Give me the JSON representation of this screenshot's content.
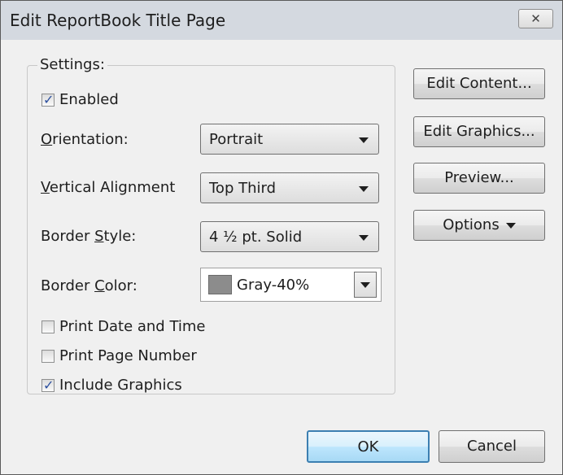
{
  "window": {
    "title": "Edit ReportBook Title Page",
    "close_glyph": "✕",
    "close_icon": "close-icon"
  },
  "settings": {
    "group_title": "Settings:",
    "enabled": {
      "label": "Enabled",
      "checked": true
    },
    "orientation": {
      "label_pre": "",
      "label_u": "O",
      "label_post": "rientation:",
      "value": "Portrait"
    },
    "vertical_alignment": {
      "label_pre": "",
      "label_u": "V",
      "label_post": "ertical Alignment",
      "value": "Top Third"
    },
    "border_style": {
      "label_pre": "Border ",
      "label_u": "S",
      "label_post": "tyle:",
      "value": "4 ½ pt. Solid"
    },
    "border_color": {
      "label_pre": "Border ",
      "label_u": "C",
      "label_post": "olor:",
      "value": "Gray-40%",
      "swatch": "#8c8c8c"
    },
    "print_date_time": {
      "label": "Print Date and Time",
      "checked": false
    },
    "print_page_number": {
      "label": "Print Page Number",
      "checked": false
    },
    "include_graphics": {
      "label": "Include Graphics",
      "checked": true
    }
  },
  "side_buttons": {
    "edit_content": "Edit Content...",
    "edit_graphics": "Edit Graphics...",
    "preview": "Preview...",
    "options": "Options"
  },
  "footer": {
    "ok": "OK",
    "cancel": "Cancel"
  },
  "check_glyph": "✓",
  "colors": {
    "titlebar": "#d4d9e0",
    "default_button_border": "#3c7fb1",
    "checkmark": "#2c4f9e"
  }
}
